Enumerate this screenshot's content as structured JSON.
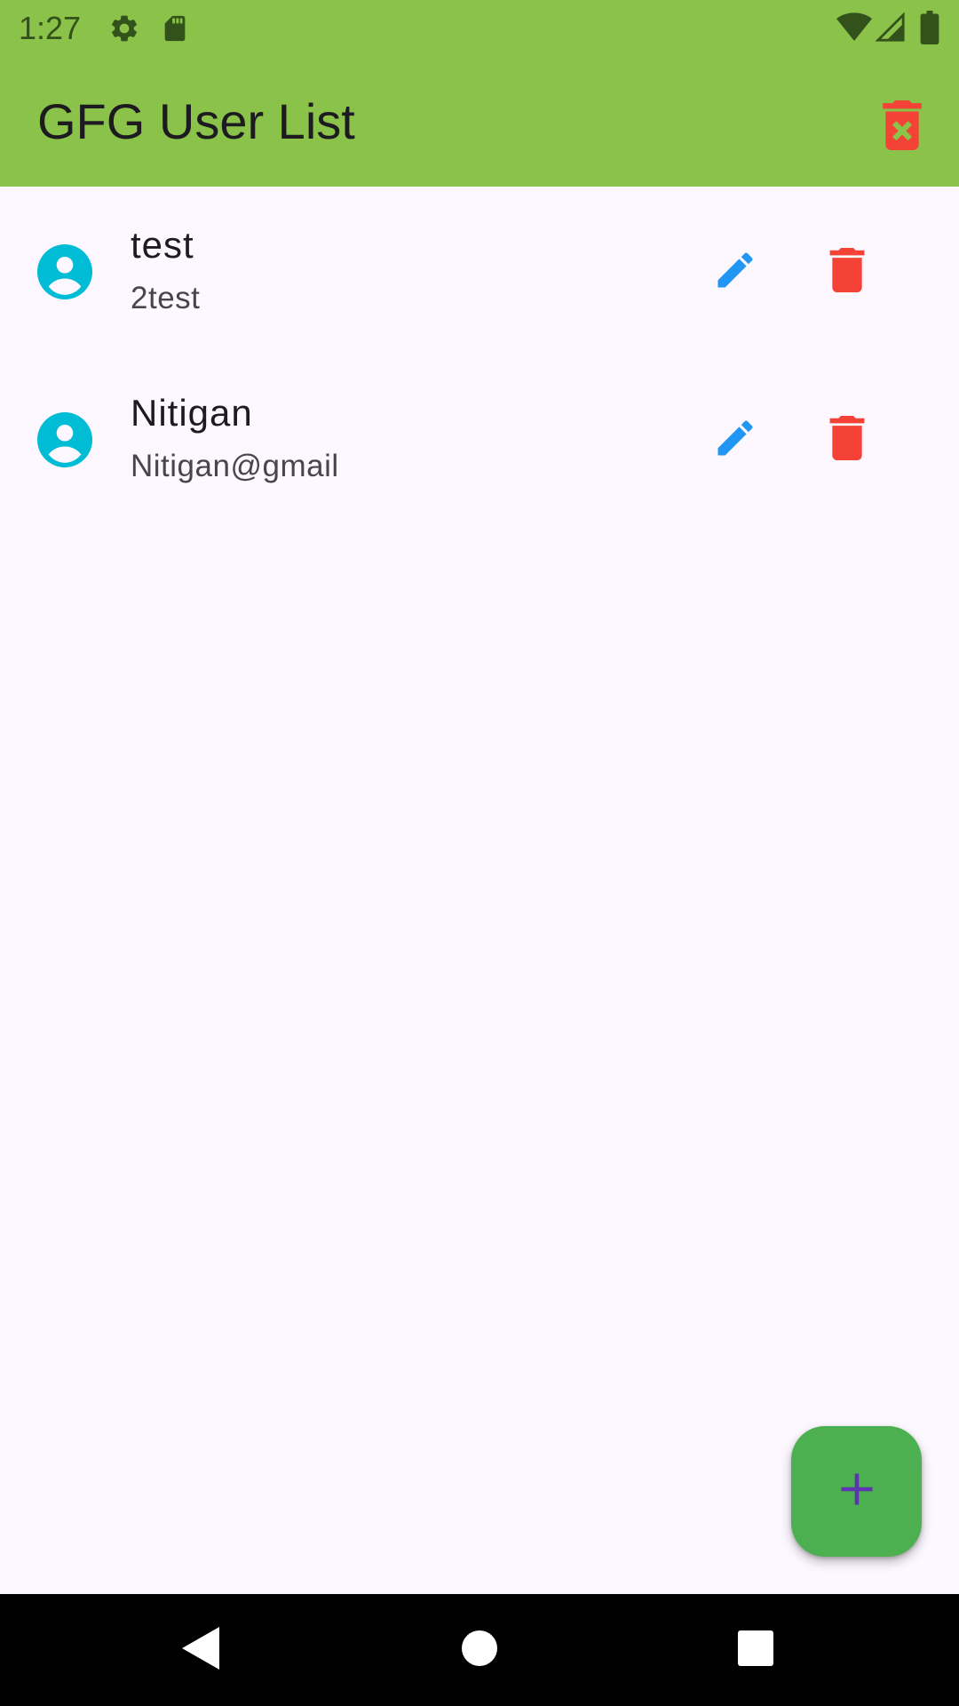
{
  "status_bar": {
    "time": "1:27",
    "icons": [
      "settings-icon",
      "sd-card-icon",
      "wifi-icon",
      "signal-icon",
      "battery-icon"
    ],
    "color": "#8BC34A"
  },
  "app_bar": {
    "title": "GFG User List",
    "action_icon": "delete-forever-icon",
    "color": "#8BC34A"
  },
  "users": [
    {
      "name": "test",
      "email": "2test"
    },
    {
      "name": "Nitigan",
      "email": "Nitigan@gmail"
    }
  ],
  "row_actions": {
    "edit_icon": "edit-icon",
    "delete_icon": "delete-icon",
    "edit_color": "#2196F3",
    "delete_color": "#F44336"
  },
  "avatar_color": "#00BCD4",
  "fab": {
    "icon": "add-icon",
    "color": "#4CAF50",
    "icon_color": "#5E35B1"
  },
  "nav_bar": {
    "buttons": [
      "back-icon",
      "home-icon",
      "recents-icon"
    ]
  }
}
